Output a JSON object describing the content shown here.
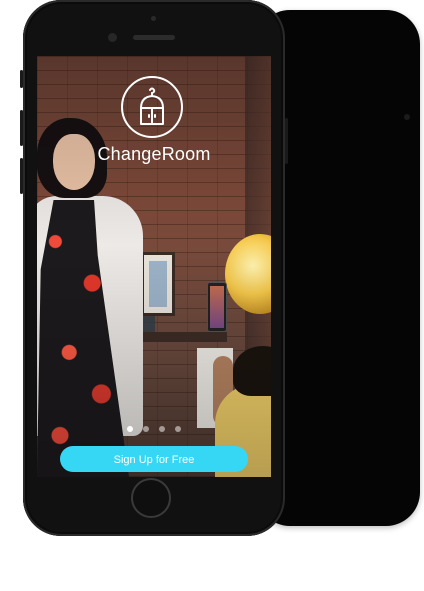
{
  "app": {
    "name": "ChangeRoom",
    "logo_icon": "wardrobe-icon"
  },
  "onboarding": {
    "pages_total": 4,
    "current_page": 1
  },
  "cta": {
    "label": "Sign Up for Free",
    "color": "#36d7f4"
  },
  "device": {
    "home_button_icon": "home-button"
  }
}
